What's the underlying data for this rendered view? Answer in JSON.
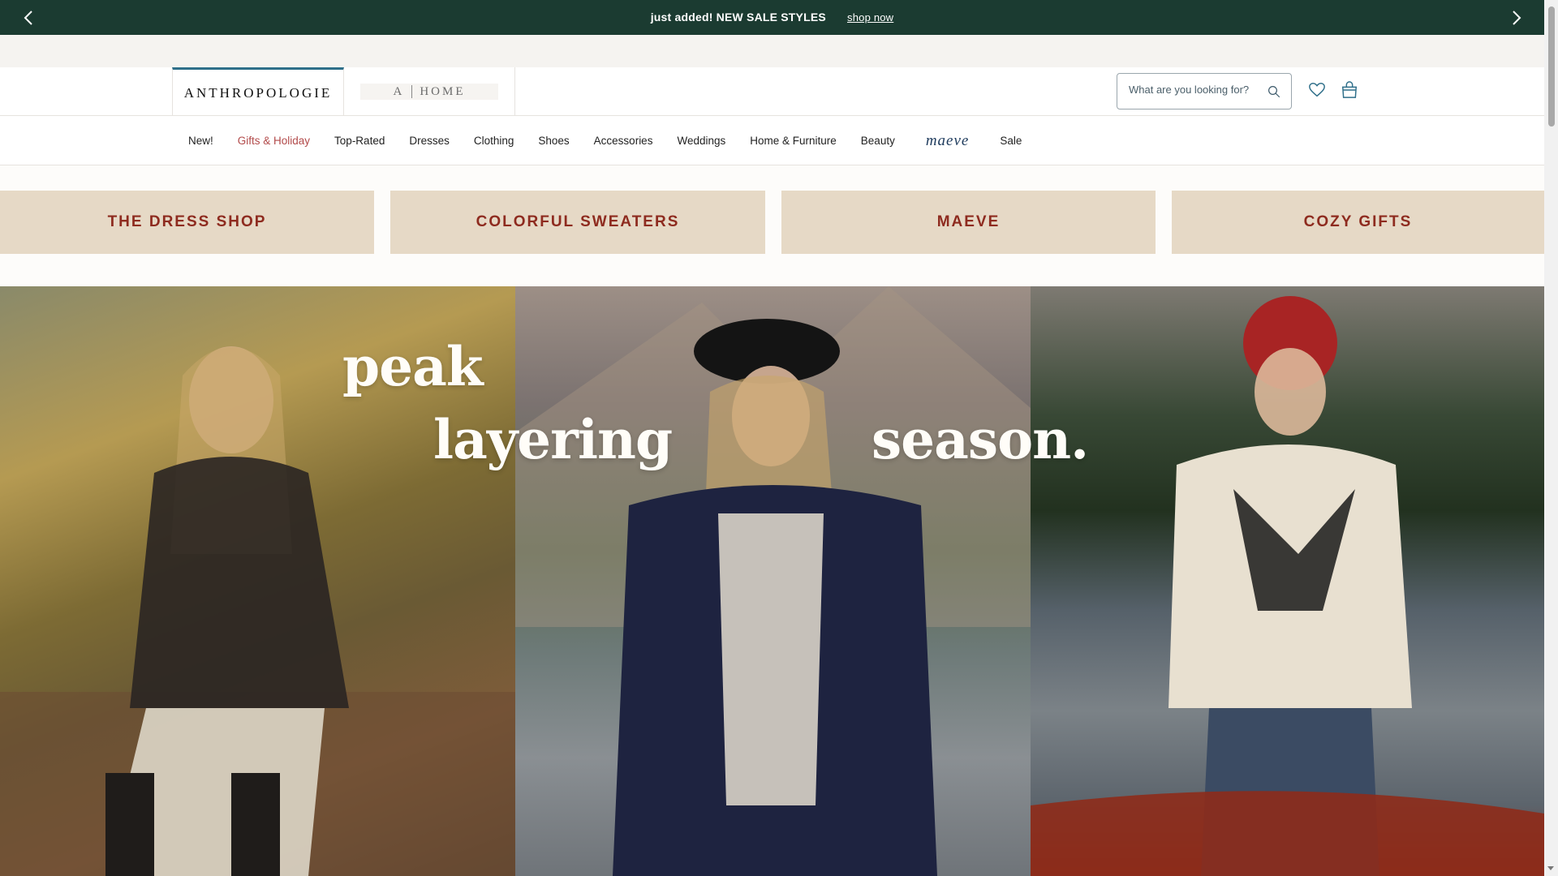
{
  "promo": {
    "message": "just added! NEW SALE STYLES",
    "link": "shop now"
  },
  "header": {
    "brand": "ANTHROPOLOGIE",
    "home_left": "A",
    "home_right": "HOME",
    "search_placeholder": "What are you looking for?"
  },
  "nav": {
    "items": [
      "New!",
      "Gifts & Holiday",
      "Top-Rated",
      "Dresses",
      "Clothing",
      "Shoes",
      "Accessories",
      "Weddings",
      "Home & Furniture",
      "Beauty",
      "maeve",
      "Sale"
    ]
  },
  "tiles": [
    "THE DRESS SHOP",
    "COLORFUL SWEATERS",
    "MAEVE",
    "COZY GIFTS"
  ],
  "hero": {
    "word1": "peak",
    "word2": "layering",
    "word3": "season."
  },
  "colors": {
    "promo_bg": "#1b3b31",
    "tile_bg": "#e6d9c6",
    "tile_text": "#8e2b1f",
    "nav_highlight": "#b24a4a",
    "brand_accent": "#2f6f8a"
  }
}
